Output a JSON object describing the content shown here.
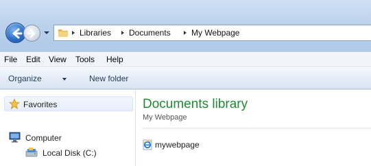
{
  "address_bar": {
    "breadcrumbs": [
      "Libraries",
      "Documents",
      "My Webpage"
    ],
    "folder_icon": "folder-icon"
  },
  "nav_buttons": {
    "back_icon": "back-arrow-icon",
    "forward_icon": "forward-arrow-icon",
    "history_icon": "chevron-down-icon"
  },
  "menu": {
    "items": [
      "File",
      "Edit",
      "View",
      "Tools",
      "Help"
    ]
  },
  "command_bar": {
    "organize_label": "Organize",
    "new_folder_label": "New folder"
  },
  "nav_pane": {
    "favorites_label": "Favorites",
    "computer_label": "Computer",
    "local_disk_label": "Local Disk (C:)"
  },
  "content": {
    "title": "Documents library",
    "subtitle": "My Webpage",
    "files": [
      {
        "name": "mywebpage",
        "icon": "internet-explorer-icon"
      }
    ]
  },
  "colors": {
    "title_green": "#1e8b33",
    "glass_blue": "#bcd3ec",
    "back_button_blue": "#2d6fc4"
  }
}
